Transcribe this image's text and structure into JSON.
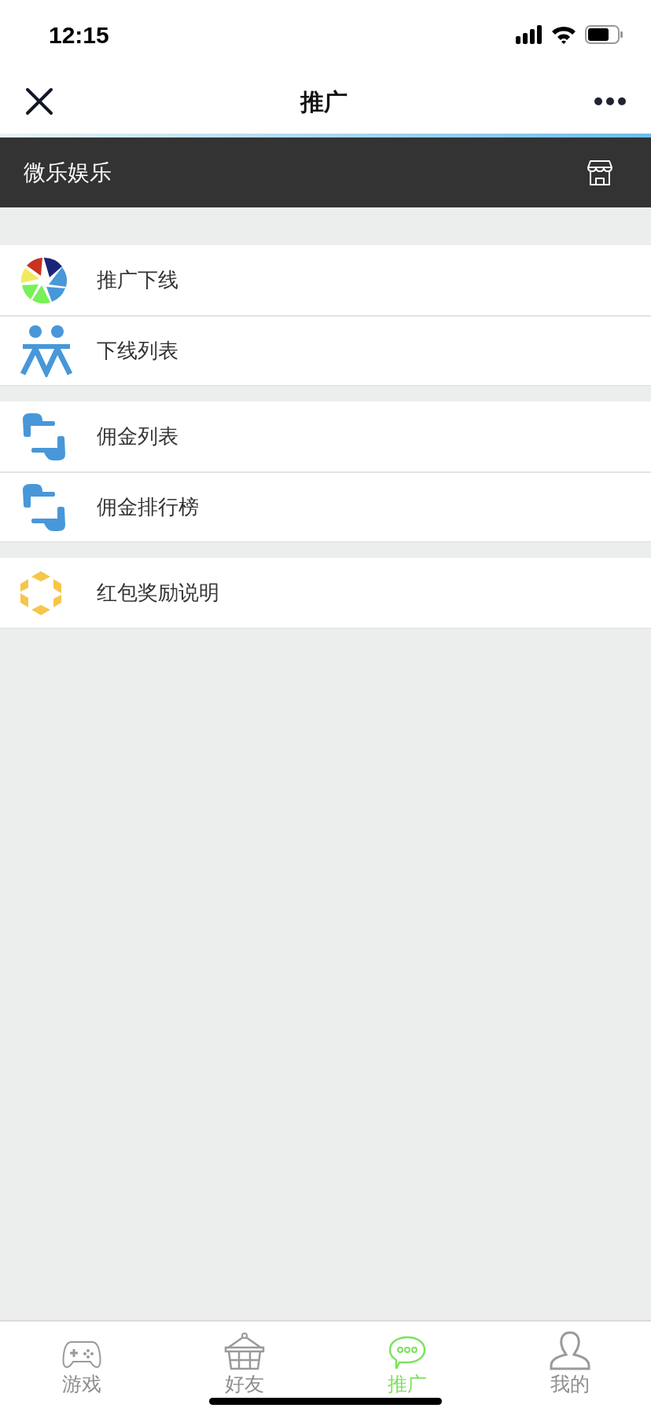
{
  "status_bar": {
    "time": "12:15"
  },
  "nav_bar": {
    "title": "推广"
  },
  "header": {
    "title": "微乐娱乐"
  },
  "menu_groups": [
    [
      {
        "label": "推广下线",
        "kind": "aperture"
      },
      {
        "label": "下线列表",
        "kind": "people"
      }
    ],
    [
      {
        "label": "佣金列表",
        "kind": "swap"
      },
      {
        "label": "佣金排行榜",
        "kind": "swap"
      }
    ],
    [
      {
        "label": "红包奖励说明",
        "kind": "hexagon"
      }
    ]
  ],
  "tabs": [
    {
      "label": "游戏",
      "kind": "gamepad",
      "selected": false
    },
    {
      "label": "好友",
      "kind": "basket",
      "selected": false
    },
    {
      "label": "推广",
      "kind": "chat",
      "selected": true
    },
    {
      "label": "我的",
      "kind": "person",
      "selected": false
    }
  ]
}
